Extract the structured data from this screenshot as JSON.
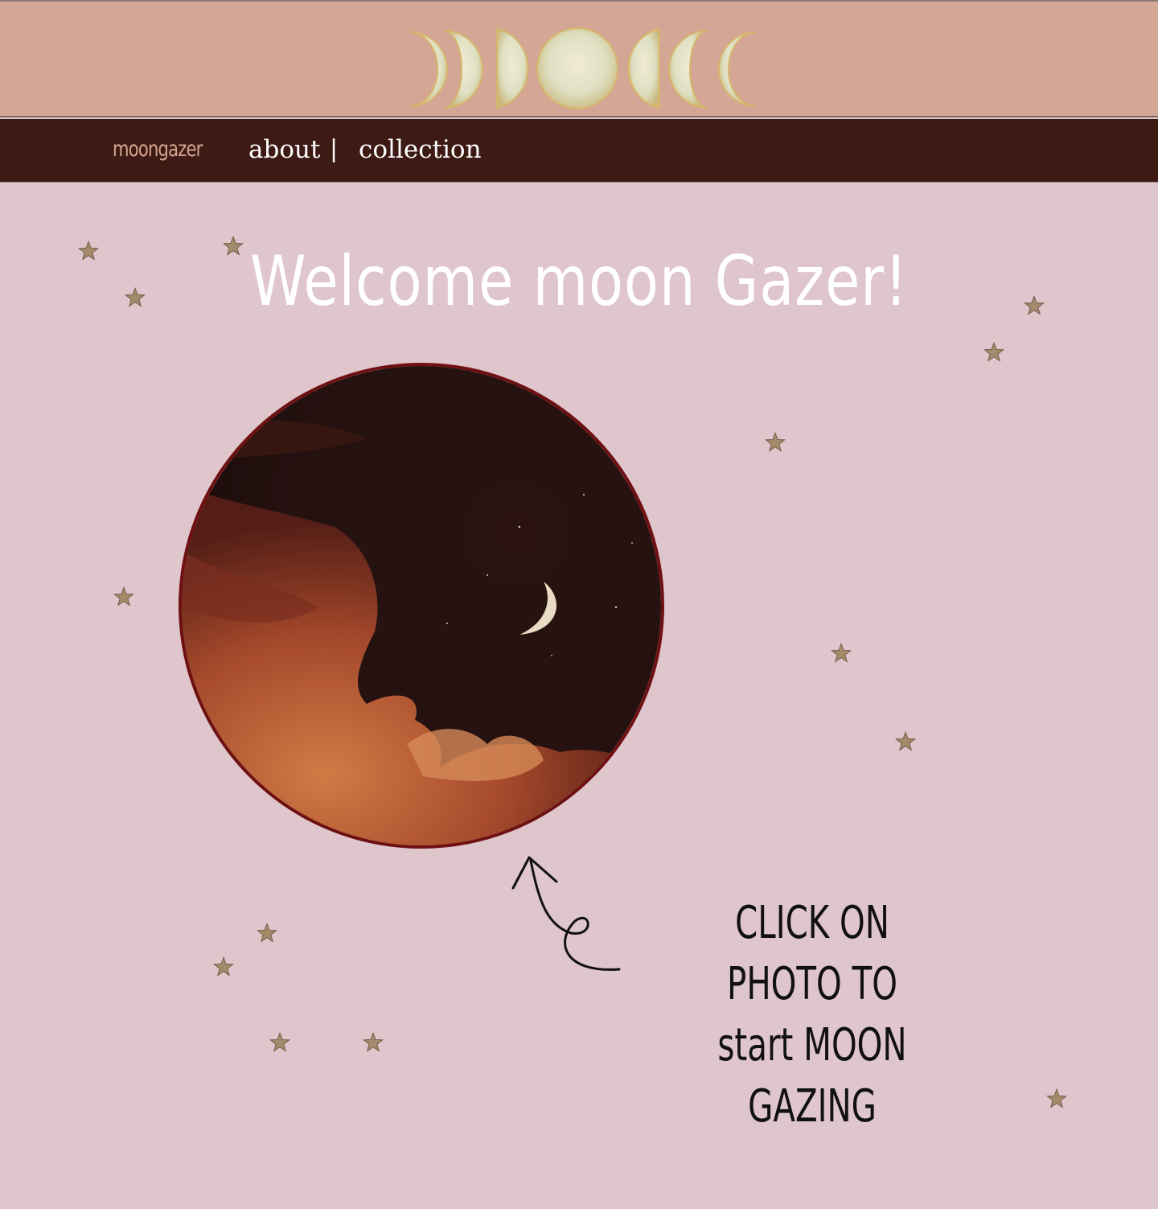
{
  "header": {
    "logo_icon": "moon-phases-icon",
    "colors": {
      "banner": "#d4a695",
      "nav": "#3d1b14",
      "page": "#dfc5cc",
      "brand": "#d6a48f"
    }
  },
  "nav": {
    "brand": "moongazer",
    "links": [
      {
        "label": "about"
      },
      {
        "label": "collection"
      }
    ],
    "separator": "|"
  },
  "main": {
    "title": "Welcome moon Gazer!",
    "photo_icon": "crescent-moon-night-sky-photo",
    "hint_line1": "CLICK ON PHOTO TO",
    "hint_line2": "start MOON GAZING",
    "arrow_icon": "curly-arrow-icon",
    "decoration_icon": "star-icon"
  }
}
